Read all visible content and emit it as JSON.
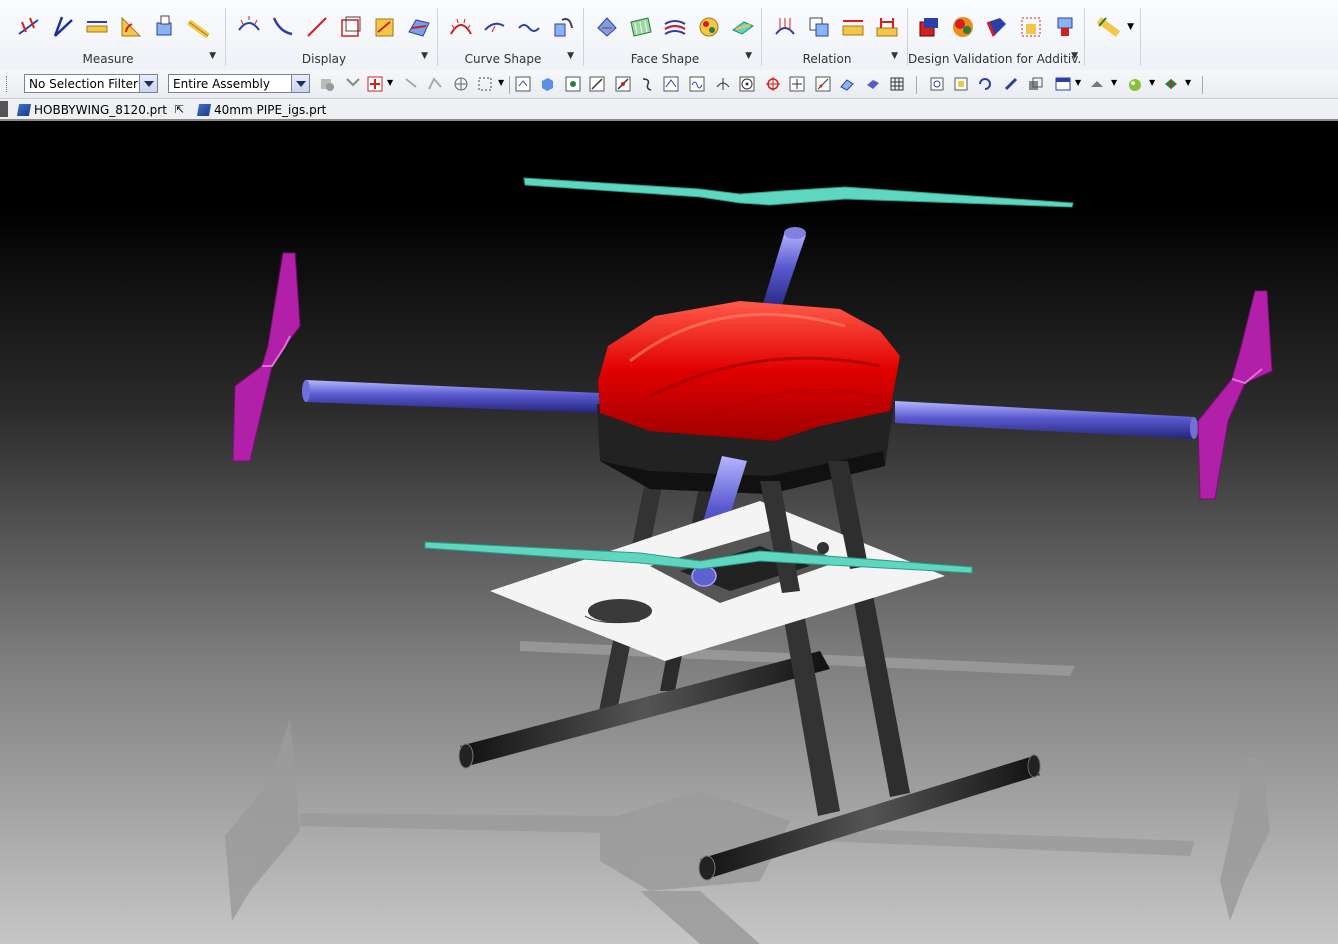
{
  "ribbon": {
    "groups": [
      {
        "label": "Measure"
      },
      {
        "label": "Display"
      },
      {
        "label": "Curve Shape"
      },
      {
        "label": "Face Shape"
      },
      {
        "label": "Relation"
      },
      {
        "label": "Design Validation for Additiv..."
      }
    ]
  },
  "selection_bar": {
    "filter_value": "No Selection Filter",
    "scope_value": "Entire Assembly"
  },
  "tabs": [
    {
      "label": "HOBBYWING_8120.prt"
    },
    {
      "label": "40mm PIPE_igs.prt"
    }
  ],
  "colors": {
    "body_red": "#e00000",
    "arm_blue": "#5a5ad0",
    "prop_teal": "#5ed6c0",
    "prop_magenta": "#b21fa8",
    "frame_dark": "#2a2a2a"
  },
  "icons": [
    "measure-distance-icon",
    "measure-angle-icon",
    "measure-length-icon",
    "measure-radius-icon",
    "measure-body-icon",
    "tape-measure-icon"
  ]
}
